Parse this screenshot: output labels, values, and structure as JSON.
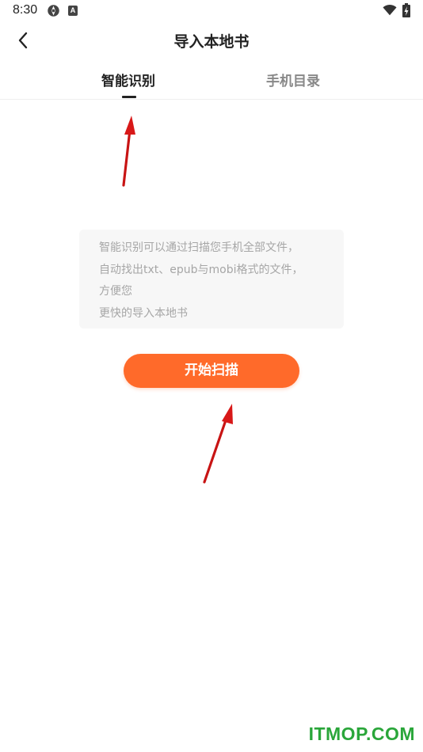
{
  "status_bar": {
    "time": "8:30",
    "app_icon_letter": "A",
    "icons": [
      "settings-like-icon",
      "a-badge-icon",
      "wifi-icon",
      "battery-charging-icon"
    ]
  },
  "header": {
    "title": "导入本地书",
    "back_icon": "chevron-left-icon"
  },
  "tabs": [
    {
      "label": "智能识别",
      "active": true
    },
    {
      "label": "手机目录",
      "active": false
    }
  ],
  "info": {
    "lines": [
      "智能识别可以通过扫描您手机全部文件，",
      "自动找出txt、epub与mobi格式的文件，",
      "方便您",
      "更快的导入本地书"
    ]
  },
  "scan_button": {
    "label": "开始扫描"
  },
  "colors": {
    "accent": "#ff6a2a",
    "info_bg": "#f7f7f7",
    "info_text": "#a6a6a6",
    "arrow": "#e0191a",
    "watermark": "#2aa63a"
  },
  "watermark": "ITMOP.COM"
}
